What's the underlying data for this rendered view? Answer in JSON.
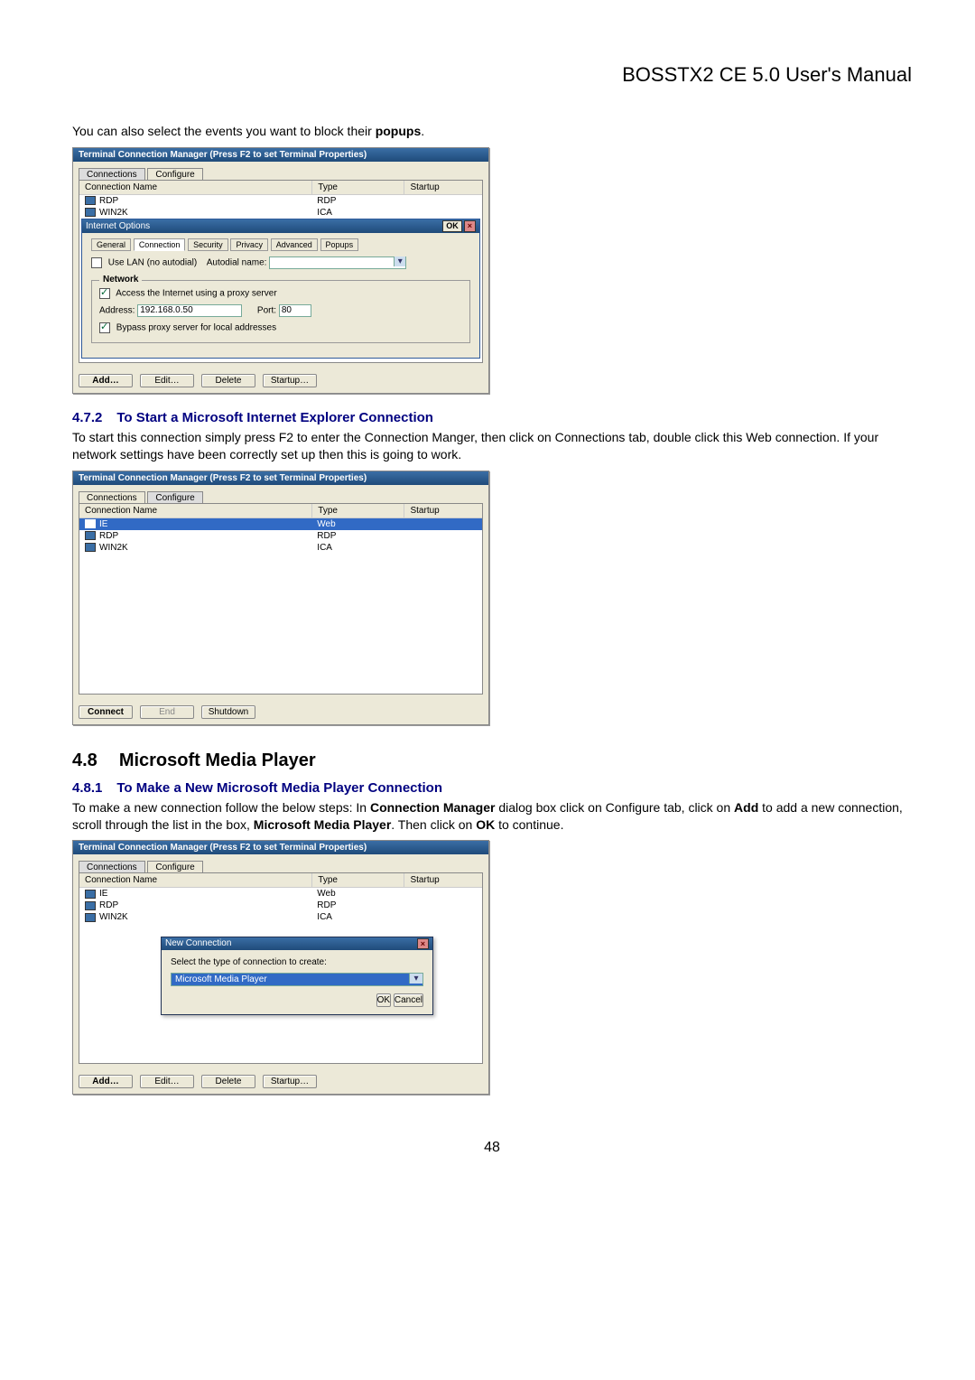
{
  "doc": {
    "header": "BOSSTX2 CE 5.0 User's Manual",
    "page_number": "48",
    "intro1_a": "You can also select the events you want to block their ",
    "intro1_b": "popups",
    "intro1_c": ".",
    "section472_num": "4.7.2",
    "section472_title": "To Start a Microsoft Internet Explorer Connection",
    "section472_body": "To start this connection simply press F2 to enter the Connection Manger, then click on Connections tab, double click this Web connection. If your network settings have been correctly set up then this is going to work.",
    "section48_num": "4.8",
    "section48_title": "Microsoft Media Player",
    "section481_num": "4.8.1",
    "section481_title": "To Make a New Microsoft Media Player Connection",
    "section481_body_a": "To make a new connection follow the below steps: In ",
    "section481_body_b": "Connection Manager",
    "section481_body_c": " dialog box click on Configure tab, click on ",
    "section481_body_d": "Add",
    "section481_body_e": " to add a new connection, scroll through the list in the box, ",
    "section481_body_f": "Microsoft Media Player",
    "section481_body_g": ". Then click on ",
    "section481_body_h": "OK",
    "section481_body_i": " to continue."
  },
  "shot1": {
    "win_title": "Terminal Connection Manager (Press F2 to set Terminal Properties)",
    "tab_connections": "Connections",
    "tab_configure": "Configure",
    "hdr_name": "Connection Name",
    "hdr_type": "Type",
    "hdr_startup": "Startup",
    "rows": [
      {
        "name": "RDP",
        "type": "RDP"
      },
      {
        "name": "WIN2K",
        "type": "ICA"
      }
    ],
    "io_title": "Internet Options",
    "io_ok": "OK",
    "io_x": "×",
    "io_tabs": [
      "General",
      "Connection",
      "Security",
      "Privacy",
      "Advanced",
      "Popups"
    ],
    "io_use_lan": "Use LAN (no autodial)",
    "io_autodial": "Autodial name:",
    "io_network": "Network",
    "io_access_proxy": "Access the Internet using a proxy server",
    "io_address_lbl": "Address:",
    "io_address_val": "192.168.0.50",
    "io_port_lbl": "Port:",
    "io_port_val": "80",
    "io_bypass": "Bypass proxy server for local addresses",
    "btn_add": "Add…",
    "btn_edit": "Edit…",
    "btn_delete": "Delete",
    "btn_startup": "Startup…"
  },
  "shot2": {
    "win_title": "Terminal Connection Manager (Press F2 to set Terminal Properties)",
    "tab_connections": "Connections",
    "tab_configure": "Configure",
    "hdr_name": "Connection Name",
    "hdr_type": "Type",
    "hdr_startup": "Startup",
    "rows": [
      {
        "name": "IE",
        "type": "Web",
        "sel": true
      },
      {
        "name": "RDP",
        "type": "RDP"
      },
      {
        "name": "WIN2K",
        "type": "ICA"
      }
    ],
    "btn_connect": "Connect",
    "btn_end": "End",
    "btn_shutdown": "Shutdown"
  },
  "shot3": {
    "win_title": "Terminal Connection Manager (Press F2 to set Terminal Properties)",
    "tab_connections": "Connections",
    "tab_configure": "Configure",
    "hdr_name": "Connection Name",
    "hdr_type": "Type",
    "hdr_startup": "Startup",
    "rows": [
      {
        "name": "IE",
        "type": "Web"
      },
      {
        "name": "RDP",
        "type": "RDP"
      },
      {
        "name": "WIN2K",
        "type": "ICA"
      }
    ],
    "modal_title": "New Connection",
    "modal_x": "×",
    "modal_prompt": "Select the type of connection to create:",
    "modal_selected": "Microsoft Media Player",
    "modal_ok": "OK",
    "modal_cancel": "Cancel",
    "btn_add": "Add…",
    "btn_edit": "Edit…",
    "btn_delete": "Delete",
    "btn_startup": "Startup…"
  }
}
